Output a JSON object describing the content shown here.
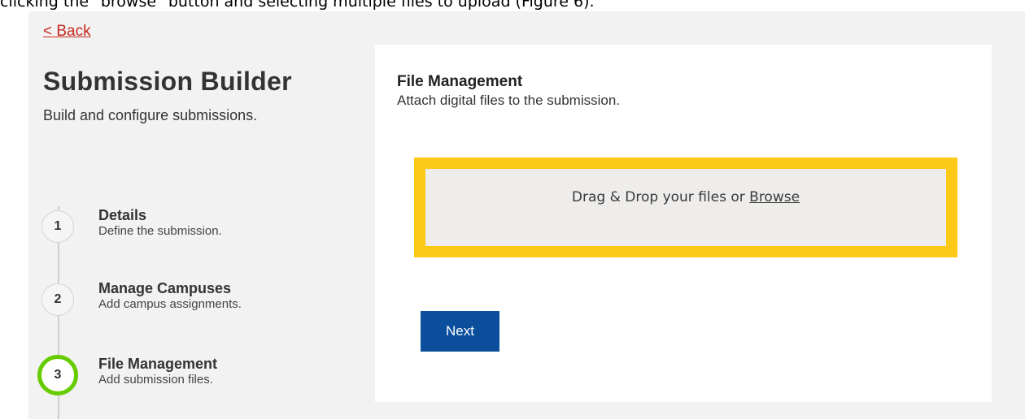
{
  "document": {
    "caption": "clicking the \"browse\" button and selecting multiple files to upload (Figure 6)."
  },
  "header": {
    "back_label": "< Back",
    "title": "Submission Builder",
    "subtitle": "Build and configure submissions."
  },
  "steps": [
    {
      "number": "1",
      "title": "Details",
      "description": "Define the submission.",
      "active": false
    },
    {
      "number": "2",
      "title": "Manage Campuses",
      "description": "Add campus assignments.",
      "active": false
    },
    {
      "number": "3",
      "title": "File Management",
      "description": "Add submission files.",
      "active": true
    }
  ],
  "panel": {
    "title": "File Management",
    "subtitle": "Attach digital files to the submission.",
    "dropzone": {
      "text": "Drag & Drop your files or ",
      "browse_label": "Browse"
    },
    "next_label": "Next"
  },
  "colors": {
    "back_link": "#c8281e",
    "active_step_ring": "#66cc00",
    "dropzone_highlight": "#fcc917",
    "primary_button": "#0b4f9c"
  }
}
